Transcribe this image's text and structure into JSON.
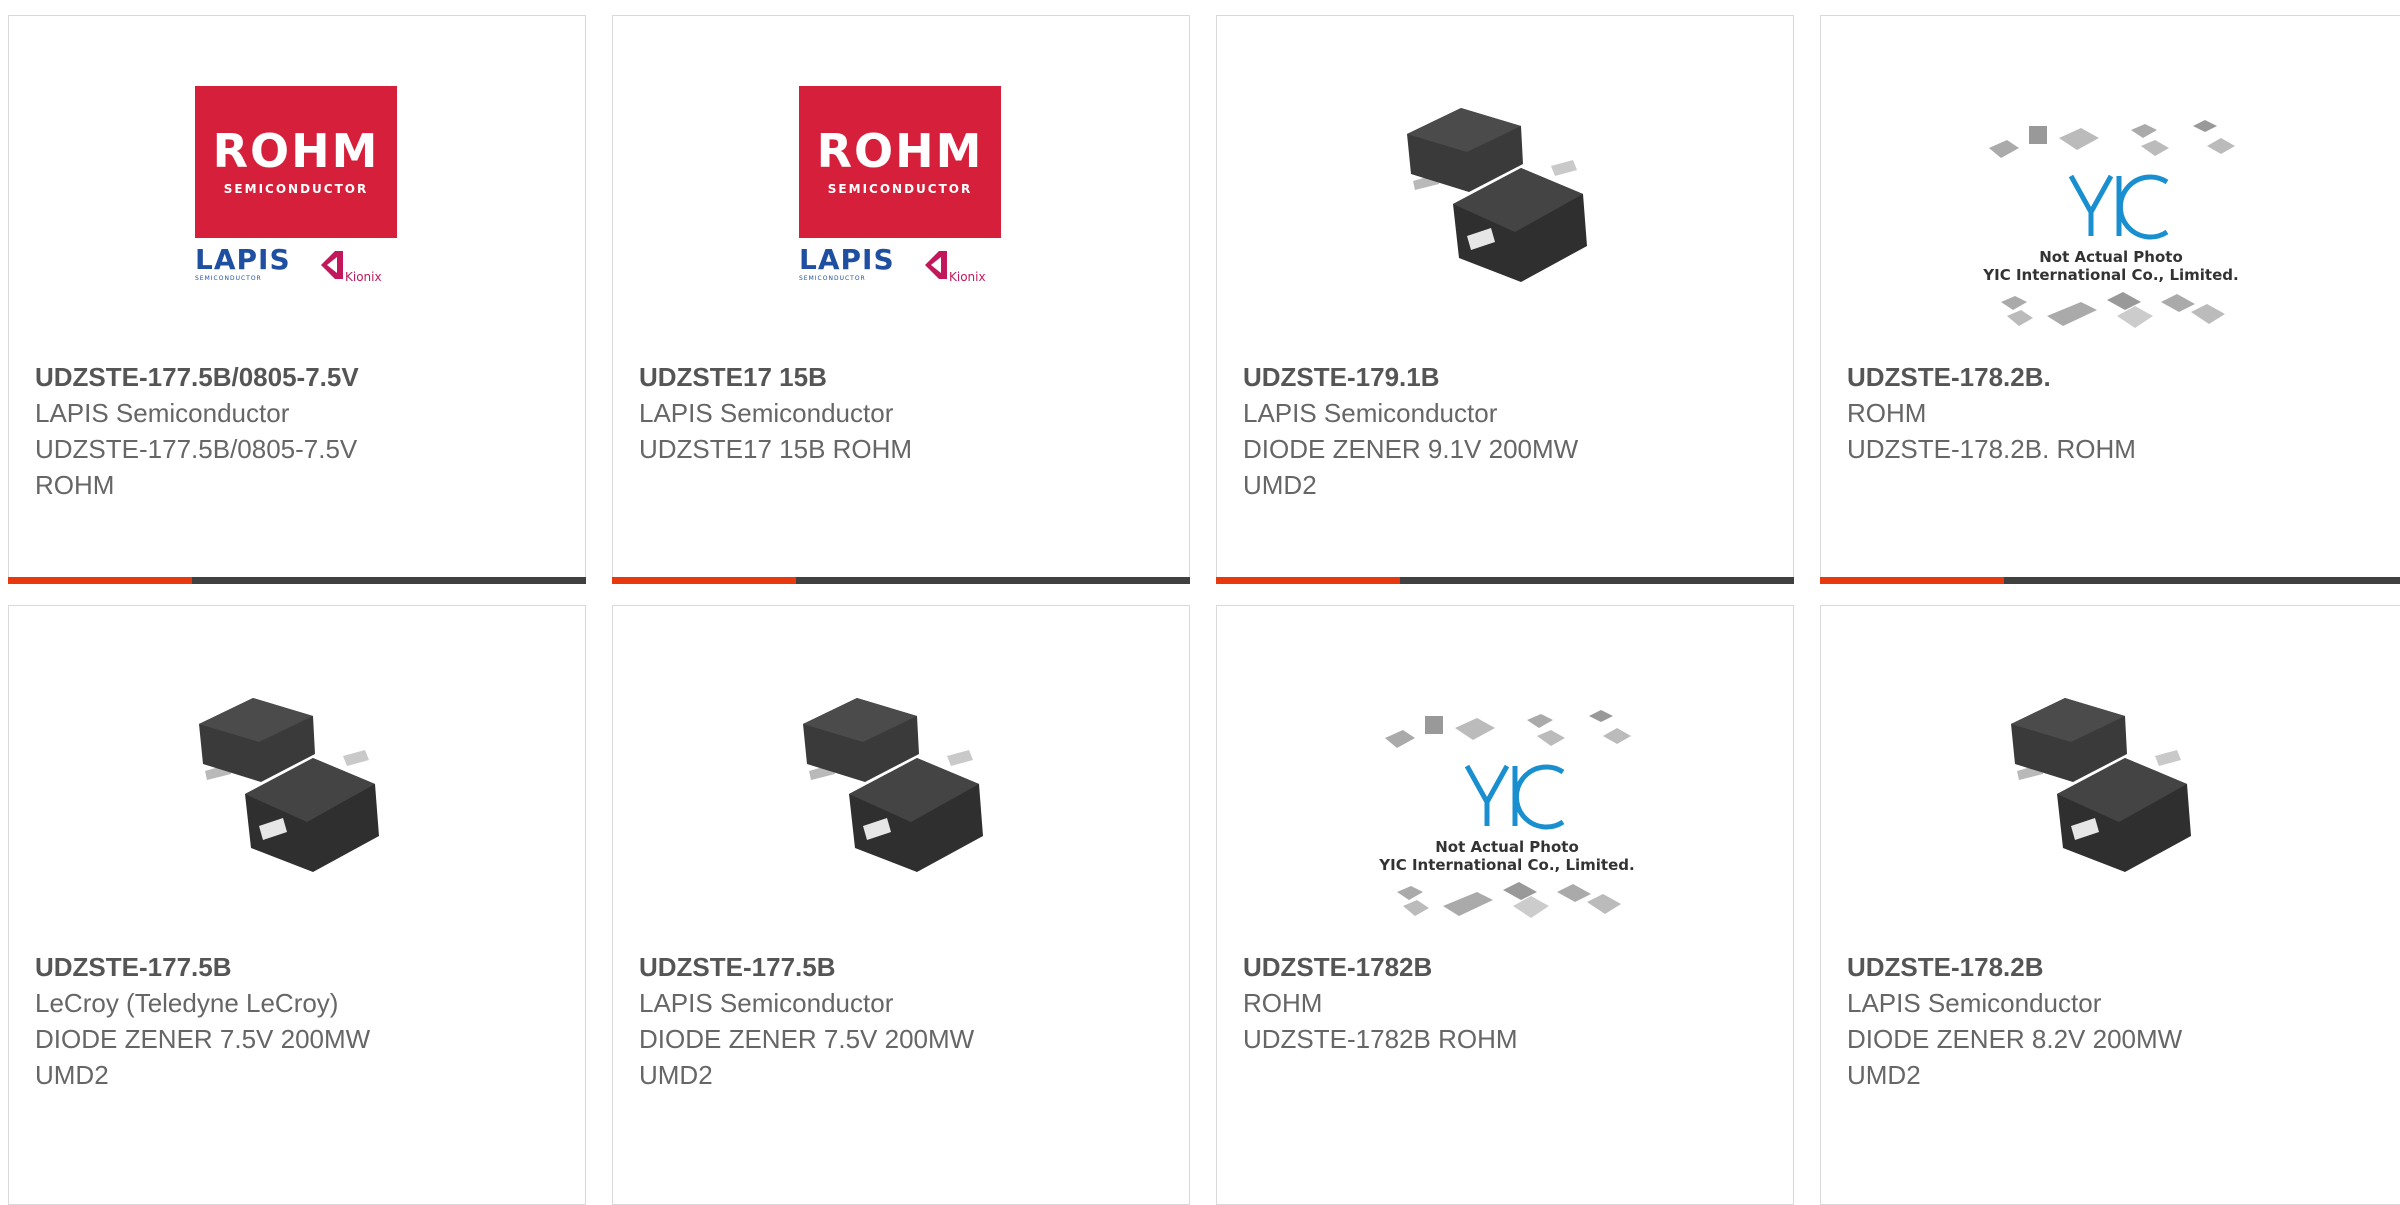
{
  "products": [
    {
      "part": "UDZSTE-177.5B/0805-7.5V",
      "manufacturer": "LAPIS Semiconductor",
      "description": "UDZSTE-177.5B/0805-7.5V\nROHM",
      "image": "rohm-lapis-logo"
    },
    {
      "part": "UDZSTE17 15B",
      "manufacturer": "LAPIS Semiconductor",
      "description": "UDZSTE17 15B ROHM",
      "image": "rohm-lapis-logo"
    },
    {
      "part": "UDZSTE-179.1B",
      "manufacturer": "LAPIS Semiconductor",
      "description": "DIODE ZENER 9.1V 200MW\nUMD2",
      "image": "umd2-package"
    },
    {
      "part": "UDZSTE-178.2B.",
      "manufacturer": "ROHM",
      "description": "UDZSTE-178.2B. ROHM",
      "image": "yic-placeholder"
    },
    {
      "part": "UDZSTE-177.5B",
      "manufacturer": "LeCroy (Teledyne LeCroy)",
      "description": "DIODE ZENER 7.5V 200MW\nUMD2",
      "image": "umd2-package"
    },
    {
      "part": "UDZSTE-177.5B",
      "manufacturer": "LAPIS Semiconductor",
      "description": "DIODE ZENER 7.5V 200MW\nUMD2",
      "image": "umd2-package"
    },
    {
      "part": "UDZSTE-1782B",
      "manufacturer": "ROHM",
      "description": "UDZSTE-1782B ROHM",
      "image": "yic-placeholder"
    },
    {
      "part": "UDZSTE-178.2B",
      "manufacturer": "LAPIS Semiconductor",
      "description": "DIODE ZENER 8.2V 200MW\nUMD2",
      "image": "umd2-package"
    }
  ],
  "logos": {
    "rohm_word": "ROHM",
    "rohm_sub": "SEMICONDUCTOR",
    "lapis_word": "LAPIS",
    "lapis_sub": "SEMICONDUCTOR",
    "kionix_word": "Kionix",
    "yic_line1": "Not Actual Photo",
    "yic_line2": "YIC International Co., Limited."
  },
  "colors": {
    "accent": "#e8380d",
    "bar": "#404040",
    "rohm_red": "#d6203b",
    "lapis_blue": "#1f4fa0",
    "yic_blue": "#1a8fd0"
  }
}
